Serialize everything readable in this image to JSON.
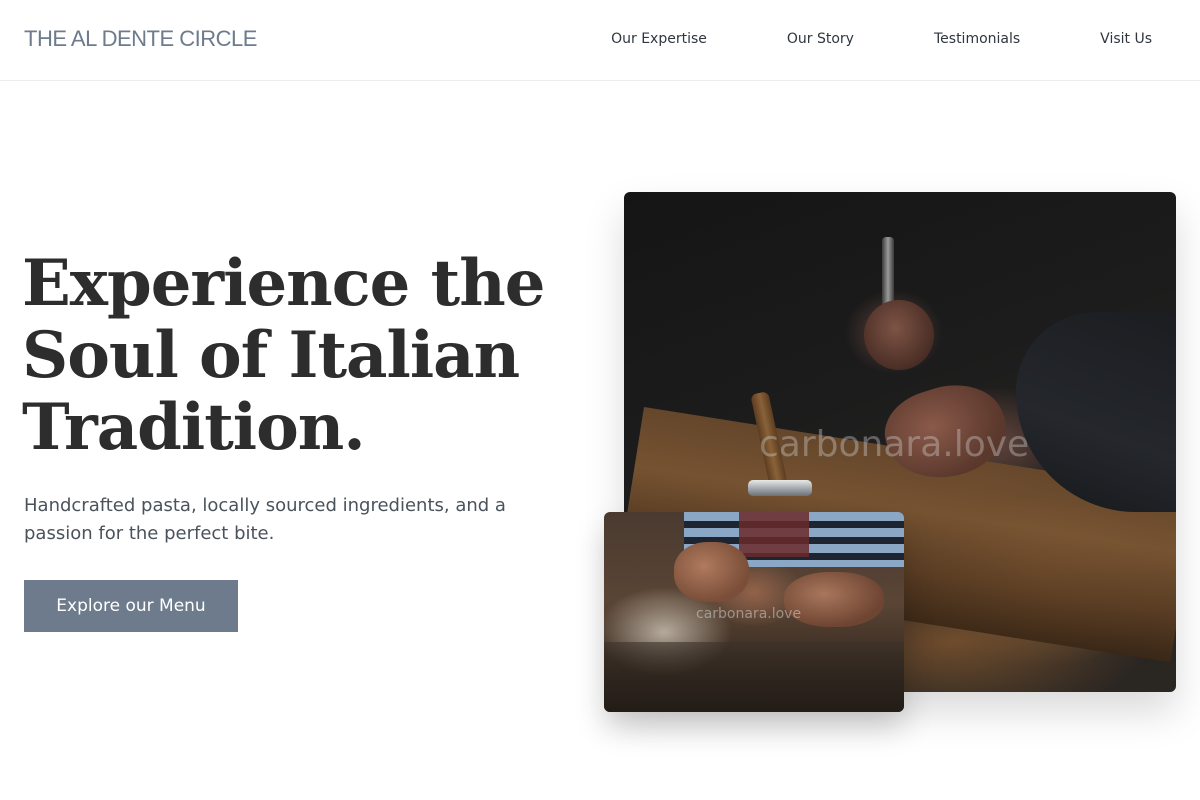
{
  "header": {
    "brand": "THE AL DENTE CIRCLE",
    "nav": [
      {
        "label": "Our Expertise"
      },
      {
        "label": "Our Story"
      },
      {
        "label": "Testimonials"
      },
      {
        "label": "Visit Us"
      }
    ]
  },
  "hero": {
    "title_lines": [
      "Experience the",
      "Soul of Italian",
      "Tradition."
    ],
    "subtitle": "Handcrafted pasta, locally sourced ingredients, and a passion for the perfect bite.",
    "cta_label": "Explore our Menu"
  },
  "images": {
    "main_watermark": "carbonara.love",
    "secondary_watermark": "carbonara.love"
  },
  "colors": {
    "accent": "#6e7b8c",
    "heading": "#2d2d2d",
    "body_text": "#4a525c",
    "background": "#ffffff"
  }
}
